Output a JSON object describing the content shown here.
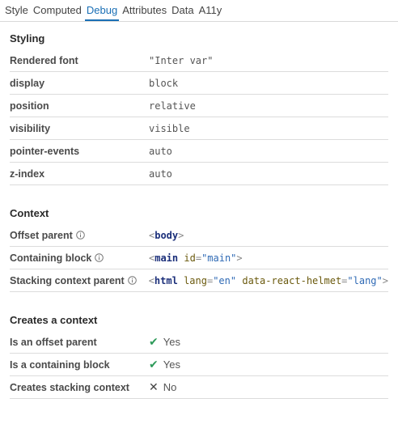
{
  "tabs": [
    {
      "label": "Style"
    },
    {
      "label": "Computed"
    },
    {
      "label": "Debug",
      "active": true
    },
    {
      "label": "Attributes"
    },
    {
      "label": "Data"
    },
    {
      "label": "A11y"
    }
  ],
  "styling": {
    "title": "Styling",
    "rows": [
      {
        "key": "Rendered font",
        "value": "\"Inter var\""
      },
      {
        "key": "display",
        "value": "block"
      },
      {
        "key": "position",
        "value": "relative"
      },
      {
        "key": "visibility",
        "value": "visible"
      },
      {
        "key": "pointer-events",
        "value": "auto"
      },
      {
        "key": "z-index",
        "value": "auto"
      }
    ]
  },
  "context": {
    "title": "Context",
    "offset_parent": {
      "key": "Offset parent",
      "tag": "body"
    },
    "containing_block": {
      "key": "Containing block",
      "tag": "main",
      "attr_name": "id",
      "attr_value": "\"main\""
    },
    "stacking_parent": {
      "key": "Stacking context parent",
      "tag": "html",
      "attr1_name": "lang",
      "attr1_value": "\"en\"",
      "attr2_name": "data-react-helmet",
      "attr2_value": "\"lang\""
    }
  },
  "creates": {
    "title": "Creates a context",
    "rows": [
      {
        "key": "Is an offset parent",
        "value": "Yes",
        "icon": "check-icon"
      },
      {
        "key": "Is a containing block",
        "value": "Yes",
        "icon": "check-icon"
      },
      {
        "key": "Creates stacking context",
        "value": "No",
        "icon": "cross-icon"
      }
    ]
  },
  "colors": {
    "active_tab": "#1a6fb5",
    "check": "#2e9b5a",
    "tag_name": "#1b2f7a",
    "attr_value": "#2f6ab5"
  }
}
